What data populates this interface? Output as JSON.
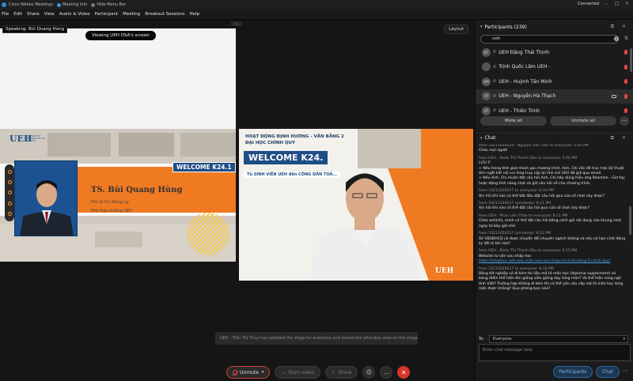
{
  "titlebar": {
    "app": "Cisco Webex Meetings",
    "meeting_info": "Meeting Info",
    "hide_menu": "Hide Menu Bar",
    "connected": "Connected"
  },
  "menu": [
    "File",
    "Edit",
    "Share",
    "View",
    "Audio & Video",
    "Participant",
    "Meeting",
    "Breakout Sessions",
    "Help"
  ],
  "stage": {
    "speaking": "Speaking: Bùi Quang Hùng",
    "viewing": "Viewing UEH DSA's screen",
    "layout": "Layout"
  },
  "slide_left": {
    "logo": "UEH",
    "logo_sub": "UNIVERSITY OF ECONOMICS HO CHI MINH CITY",
    "welcome": "WELCOME K24.1",
    "name": "TS. Bùi Quang Hùng",
    "role1": "Phó bí thư Đảng ủy",
    "role2": "Phó hiệu trưởng UEH"
  },
  "video_right": {
    "title1": "HOẠT ĐỘNG ĐỊNH HƯỚNG - VĂN BẰNG 2",
    "title2": "ĐẠI HỌC CHÍNH QUY",
    "welcome": "WELCOME K24.",
    "sub": "Từ SINH VIÊN UEH đến CÔNG DÂN TOÀ...",
    "logo": "UEH"
  },
  "toast": "UEH - Trần Thị Thùy has updated the stage for everyone and locked the attendee view on the stage only.",
  "controls": {
    "unmute": "Unmute",
    "start_video": "Start video",
    "share": "Share"
  },
  "participants": {
    "title": "Participants (239)",
    "search_value": "ueh",
    "list": [
      {
        "initials": "ĐT",
        "name": "UEH Đặng Thái Thịnh",
        "selected": false,
        "camera": false
      },
      {
        "initials": "",
        "name": "Trịnh Quốc Lâm UEH -",
        "selected": false,
        "camera": false
      },
      {
        "initials": "UM",
        "name": "UEH - Huỳnh Tấn Minh",
        "selected": false,
        "camera": false
      },
      {
        "initials": "UT",
        "name": "UEH - Nguyễn Hà Thạch",
        "selected": true,
        "camera": true
      },
      {
        "initials": "UT",
        "name": "UEH - Thiên Trinh",
        "selected": false,
        "camera": false
      }
    ],
    "mute_all": "Mute all",
    "unmute_all": "Unmute all"
  },
  "chat": {
    "title": "Chat",
    "messages": [
      {
        "from": "from 33211020224 - Nguyễn Văn Tiến to everyone:   5:00 PM",
        "lines": [
          "Chào mọi người"
        ]
      },
      {
        "from": "from UEH - Đoàn Thị Thanh Dâu to everyone:   5:00 PM",
        "lines": [
          "LƯU Ý:",
          "+ Nếu trong thời gian tham gia chương trình, Anh, Chị vẫn đổ trục trặc kỹ thuật làm ngắt kết nối vui lòng truy cập lại link mà UEH đã gửi qua email.",
          "+ Nếu Anh, Chị muốn đặt câu hỏi Anh, Chị hãy dùng hiệu ứng Reaction - Giơ tay hoặc đặng tính năng chat và gửi câu hỏi về cho chương trình."
        ]
      },
      {
        "from": "from 33211020217 to everyone:   6:10 PM",
        "lines": [
          "Xin hỏi khi nào có thể bắt đầu đặt câu hỏi qua cửa sổ chat này được?"
        ]
      },
      {
        "from": "from 33211020217 (privately):   6:11 PM",
        "lines": [
          "Xin hỏi khi nào có thể đặt câu hỏi qua cửa sổ chat này được?"
        ]
      },
      {
        "from": "from UEH - Phan Liên Thảo to everyone:   6:11 PM",
        "lines": [
          "Chào anh/chị, mình có thể đặt câu hỏi bằng cách gửi nội dung vào khung chat ngay từ bây giờ nhé."
        ]
      },
      {
        "from": "from 33211020217 (privately):   6:12 PM",
        "lines": [
          "SV VB2ĐHCQ có được chuyển đổi chuyên ngành không và nếu có hạn chót đăng ký đổi là khi nào?"
        ]
      },
      {
        "from": "from UEH - Đoàn Thị Thanh Dâu to everyone:   6:15 PM",
        "lines": [
          "Website tư vấn sau nhập học"
        ],
        "link": "https://nhaphoc.ueh.edu.vn/tu-van-sau-nhap-hoc/van-bang-2-chinh-quy/"
      },
      {
        "from": "from 33211020217 to everyone:   6:16 PM",
        "lines": [
          "Bằng tốt nghiệp có đi kèm tài liệu mô tả môn học (diploma supplement) và bảng điểm thể hiện tên giảng viên giảng dạy từng môn? Và thể hiện song ngữ Anh Việt? Trường hợp không đi kèm thì có thể yêu cầu cấp mô tả môn học từng môn được không? Qua phòng ban nào?"
        ]
      }
    ],
    "to_label": "To:",
    "to_value": "Everyone",
    "input_placeholder": "Enter chat message here"
  },
  "bottom_tabs": {
    "participants": "Participants",
    "chat": "Chat"
  }
}
